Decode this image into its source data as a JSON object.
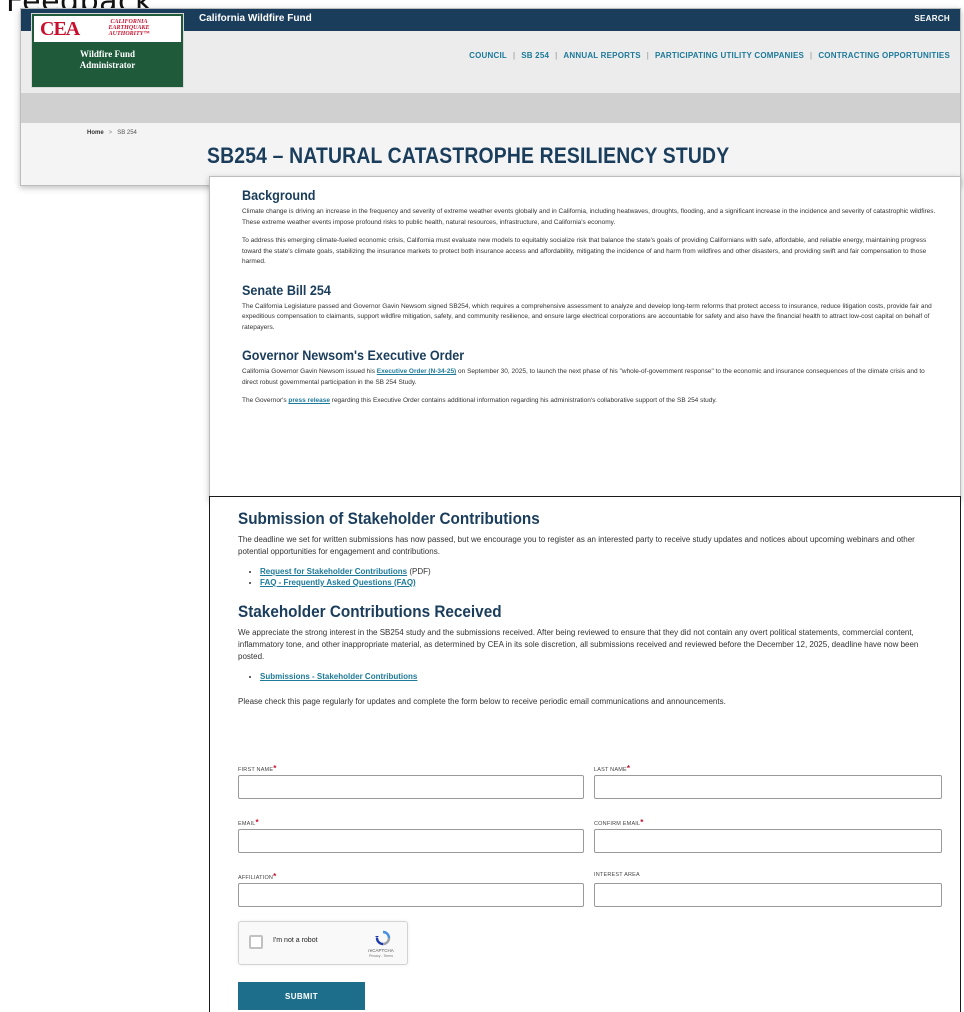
{
  "crop_fragment": "Feedback",
  "header": {
    "logo": {
      "cea": "CEA",
      "authority_lines": [
        "CALIFORNIA",
        "EARTHQUAKE",
        "AUTHORITY™"
      ],
      "sub_line1": "Wildfire Fund",
      "sub_line2": "Administrator"
    },
    "site_name": "California Wildfire Fund",
    "search_label": "SEARCH",
    "nav": [
      "COUNCIL",
      "SB 254",
      "ANNUAL REPORTS",
      "PARTICIPATING UTILITY COMPANIES",
      "CONTRACTING OPPORTUNITIES"
    ],
    "nav_separator": "|",
    "breadcrumb": {
      "home": "Home",
      "sep": ">",
      "current": "SB 254"
    },
    "page_title": "SB254 – NATURAL CATASTROPHE RESILIENCY STUDY"
  },
  "content": {
    "background": {
      "heading": "Background",
      "p1": "Climate change is driving an increase in the frequency and severity of extreme weather events globally and in California, including heatwaves, droughts, flooding, and a significant increase in the incidence and severity of catastrophic wildfires. These extreme weather events impose profound risks to public health, natural resources, infrastructure, and California's economy.",
      "p2": "To address this emerging climate-fueled economic crisis, California must evaluate new models to equitably socialize risk that balance the state's goals of providing Californians with safe, affordable, and reliable energy, maintaining progress toward the state's climate goals, stabilizing the insurance markets to protect both insurance access and affordability, mitigating the incidence of and harm from wildfires and other disasters, and providing swift and fair compensation to those harmed."
    },
    "senate_bill": {
      "heading": "Senate Bill 254",
      "p1": "The California Legislature passed and Governor Gavin Newsom signed SB254, which requires a comprehensive assessment to analyze and develop long-term reforms that protect access to insurance, reduce litigation costs, provide fair and expeditious compensation to claimants, support wildfire mitigation, safety, and community resilience, and ensure large electrical corporations are accountable for safety and also have the financial health to attract low-cost capital on behalf of ratepayers."
    },
    "executive_order": {
      "heading": "Governor Newsom's Executive Order",
      "p1_pre": "California Governor Gavin Newsom issued his ",
      "p1_link": "Executive Order (N-34-25)",
      "p1_post": " on September 30, 2025, to launch the next phase of his \"whole-of-government response\" to the economic and insurance consequences of the climate crisis and to direct robust governmental participation in the SB 254 Study.",
      "p2_pre": "The Governor's ",
      "p2_link": "press release",
      "p2_post": " regarding this Executive Order contains additional information regarding his administration's collaborative support of the SB 254 study."
    }
  },
  "form_section": {
    "submission": {
      "heading": "Submission of Stakeholder Contributions",
      "p1": "The deadline we set for written submissions has now passed, but we encourage you to register as an interested party to receive study updates and notices about upcoming webinars and other potential opportunities for engagement and contributions.",
      "links": [
        {
          "label": "Request for Stakeholder Contributions",
          "note": " (PDF)"
        },
        {
          "label": "FAQ - Frequently Asked Questions (FAQ)",
          "note": ""
        }
      ]
    },
    "received": {
      "heading": "Stakeholder Contributions Received",
      "p1": "We appreciate the strong interest in the SB254 study and the submissions received. After being reviewed to ensure that they did not contain any overt political statements, commercial content, inflammatory tone, and other inappropriate material, as determined by CEA in its sole discretion, all submissions received and reviewed before the December 12, 2025, deadline have now been posted.",
      "links": [
        {
          "label": "Submissions - Stakeholder Contributions"
        }
      ],
      "p2": "Please check this page regularly for updates and complete the form below to receive periodic email communications and announcements."
    },
    "fields": {
      "first_name": "FIRST NAME",
      "last_name": "LAST NAME",
      "email": "EMAIL",
      "confirm_email": "CONFIRM EMAIL",
      "affiliation": "AFFILIATION",
      "interest_area": "INTEREST AREA",
      "required_mark": "*"
    },
    "captcha": {
      "label": "I'm not a robot",
      "brand": "reCAPTCHA",
      "terms": "Privacy - Terms"
    },
    "submit_label": "SUBMIT"
  },
  "colors": {
    "navy": "#1a3d5c",
    "link_teal": "#1d7a9a",
    "required_red": "#c8102e",
    "logo_green": "#1f5a3b",
    "button": "#1d6e8a"
  }
}
